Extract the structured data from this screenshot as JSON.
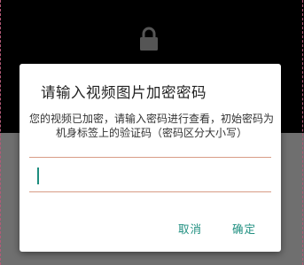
{
  "screen": {
    "background_color": "#000000",
    "bottom_overlay_color": "#6f6f6f"
  },
  "lock_icon": {
    "icon": "lock-icon",
    "color": "#555555"
  },
  "dialog": {
    "title": "请输入视频图片加密密码",
    "message": "您的视频已加密，请输入密码进行查看，初始密码为机身标签上的验证码（密码区分大小写）",
    "password_value": "",
    "cancel_label": "取消",
    "confirm_label": "确定",
    "accent_color": "#1f8f80",
    "divider_color": "#d89c86"
  }
}
